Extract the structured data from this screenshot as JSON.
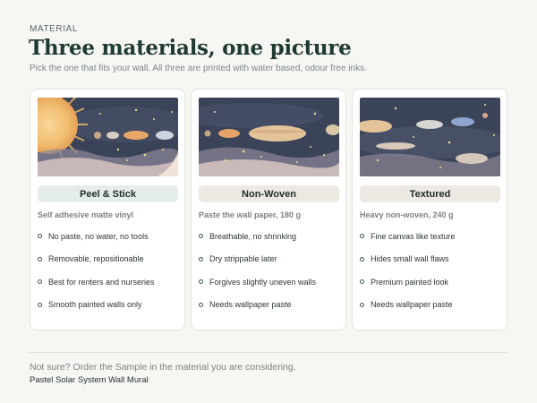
{
  "header": {
    "eyebrow": "MATERIAL",
    "title": "Three materials, one picture",
    "subtitle": "Pick the one that fits your wall. All three are printed with water based, odour free inks."
  },
  "cards": [
    {
      "name": "Peel & Stick",
      "spec": "Self adhesive matte vinyl",
      "features": [
        "No paste, no water, no tools",
        "Removable, repositionable",
        "Best for renters and nurseries",
        "Smooth painted walls only"
      ],
      "pill_color": "#e5ede8",
      "selected": true
    },
    {
      "name": "Non-Woven",
      "spec": "Paste the wall paper, 180 g",
      "features": [
        "Breathable, no shrinking",
        "Dry strippable later",
        "Forgives slightly uneven walls",
        "Needs wallpaper paste"
      ],
      "pill_color": "#ece8e2"
    },
    {
      "name": "Textured",
      "spec": "Heavy non-woven, 240 g",
      "features": [
        "Fine canvas like texture",
        "Hides small wall flaws",
        "Premium painted look",
        "Needs wallpaper paste"
      ],
      "pill_color": "#ece8e2"
    }
  ],
  "footer": {
    "note": "Not sure? Order the Sample in the material you are considering.",
    "product": "Pastel Solar System Wall Mural"
  },
  "colors": {
    "accent": "#1f3a30",
    "space_background": "#3a4358",
    "card_border": "#e3e4e0"
  }
}
